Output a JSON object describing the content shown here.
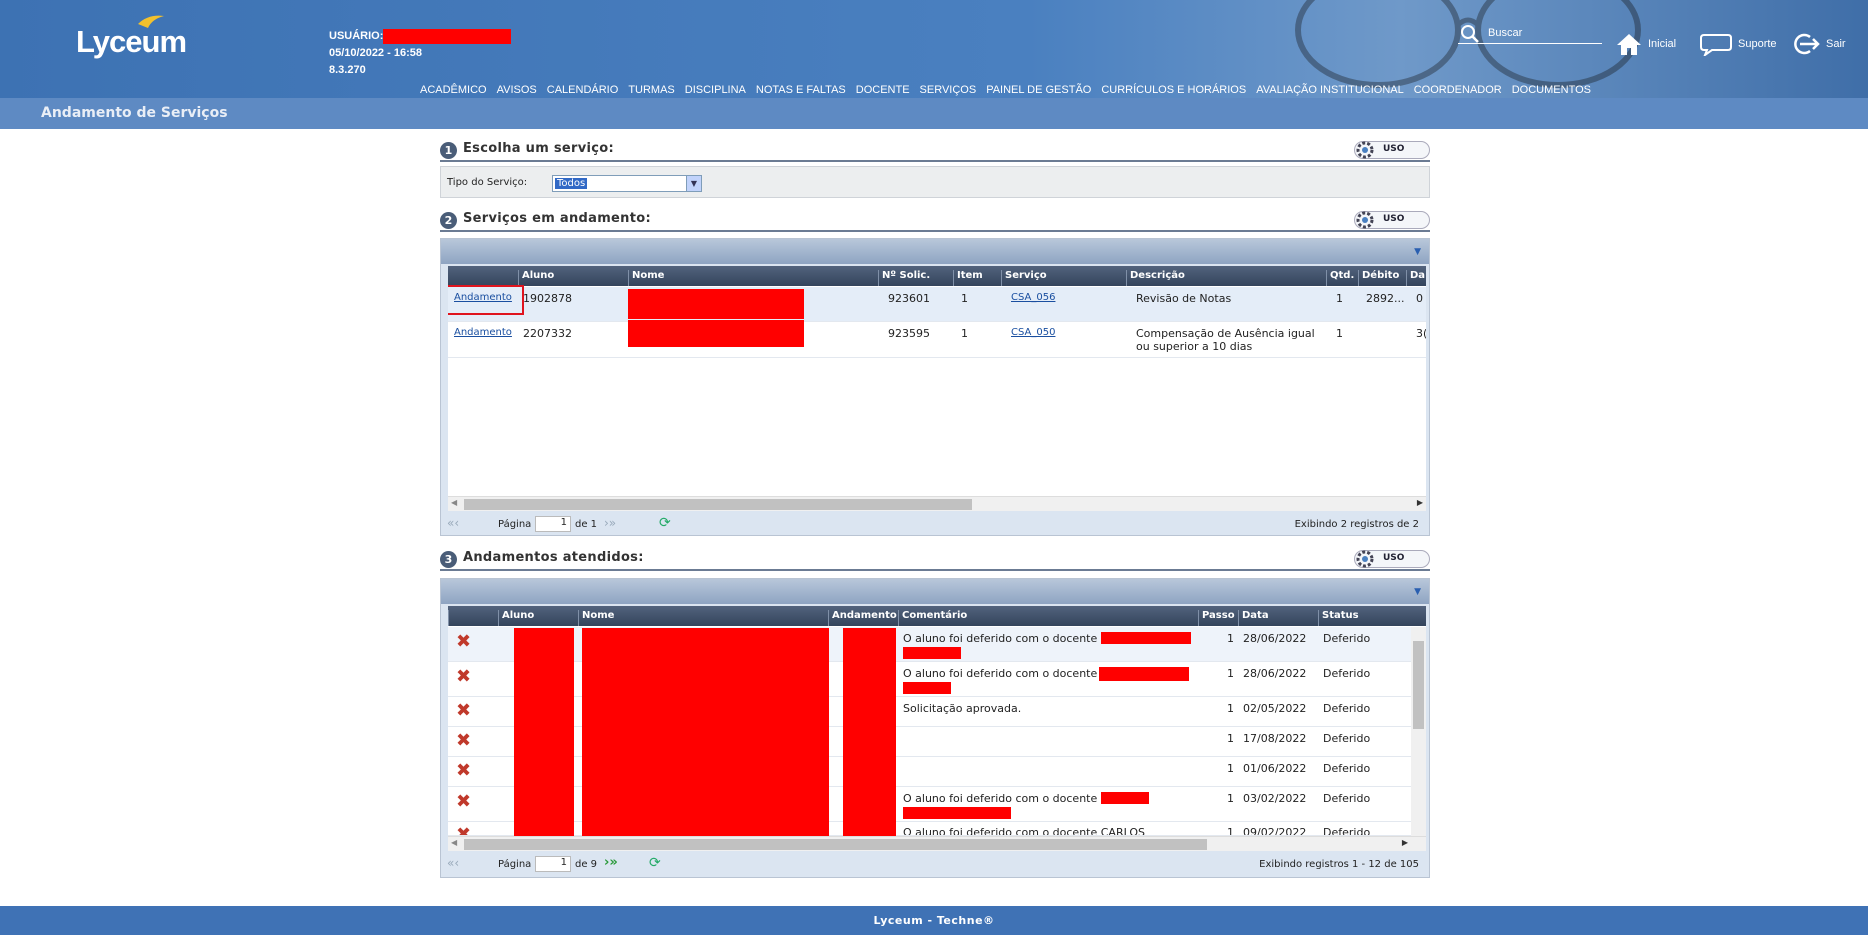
{
  "header": {
    "logo": "Lyceum",
    "user_label": "USUÁRIO:",
    "datetime": "05/10/2022 - 16:58",
    "version": "8.3.270",
    "search_label": "Buscar",
    "links": {
      "home": "Inicial",
      "support": "Suporte",
      "exit": "Sair"
    },
    "menu": [
      "ACADÊMICO",
      "AVISOS",
      "CALENDÁRIO",
      "TURMAS",
      "DISCIPLINA",
      "NOTAS E FALTAS",
      "DOCENTE",
      "SERVIÇOS",
      "PAINEL DE GESTÃO",
      "CURRÍCULOS E HORÁRIOS",
      "AVALIAÇÃO INSTITUCIONAL",
      "COORDENADOR",
      "DOCUMENTOS"
    ]
  },
  "page_title": "Andamento de Serviços",
  "section1": {
    "num": "1",
    "title": "Escolha um serviço:",
    "uso": "USO",
    "filter_label": "Tipo do Serviço:",
    "filter_value": "Todos"
  },
  "section2": {
    "num": "2",
    "title": "Serviços em andamento:",
    "uso": "USO",
    "columns": [
      "Aluno",
      "Nome",
      "Nº Solic.",
      "Item",
      "Serviço",
      "Descrição",
      "Qtd.",
      "Débito",
      "Da"
    ],
    "rows": [
      {
        "action": "Andamento",
        "aluno": "1902878",
        "solic": "923601",
        "item": "1",
        "servico": "CSA_056",
        "descricao": "Revisão de Notas",
        "qtd": "1",
        "debito": "2892...",
        "extra": "0"
      },
      {
        "action": "Andamento",
        "aluno": "2207332",
        "solic": "923595",
        "item": "1",
        "servico": "CSA_050",
        "descricao": "Compensação de Ausência igual ou superior a 10 dias",
        "qtd": "1",
        "debito": "",
        "extra": "3("
      }
    ],
    "pager": {
      "label": "Página",
      "current": "1",
      "of": "de 1",
      "summary": "Exibindo 2 registros de 2"
    }
  },
  "section3": {
    "num": "3",
    "title": "Andamentos atendidos:",
    "uso": "USO",
    "columns": [
      "Aluno",
      "Nome",
      "Andamento",
      "Comentário",
      "Passo",
      "Data",
      "Status"
    ],
    "rows": [
      {
        "comentario": "O aluno foi deferido com o docente",
        "passo": "1",
        "data": "28/06/2022",
        "status": "Deferido"
      },
      {
        "comentario": "O aluno foi deferido com o docente",
        "passo": "1",
        "data": "28/06/2022",
        "status": "Deferido"
      },
      {
        "comentario": "Solicitação aprovada.",
        "passo": "1",
        "data": "02/05/2022",
        "status": "Deferido"
      },
      {
        "comentario": "",
        "passo": "1",
        "data": "17/08/2022",
        "status": "Deferido"
      },
      {
        "comentario": "",
        "passo": "1",
        "data": "01/06/2022",
        "status": "Deferido"
      },
      {
        "comentario": "O aluno foi deferido com o docente",
        "passo": "1",
        "data": "03/02/2022",
        "status": "Deferido"
      },
      {
        "comentario": "O aluno foi deferido com o docente CARLOS",
        "passo": "1",
        "data": "09/02/2022",
        "status": "Deferido"
      }
    ],
    "pager": {
      "label": "Página",
      "current": "1",
      "of": "de 9",
      "summary": "Exibindo registros 1 - 12 de 105"
    }
  },
  "footer": "Lyceum - Techne®"
}
